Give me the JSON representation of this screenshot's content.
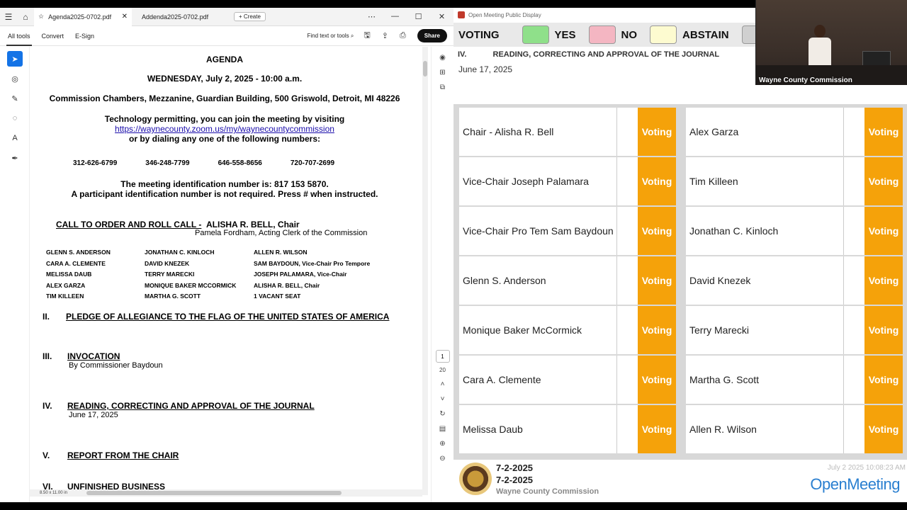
{
  "pdf": {
    "tabs": [
      {
        "label": "Agenda2025-0702.pdf",
        "active": true
      },
      {
        "label": "Addenda2025-0702.pdf",
        "active": false
      }
    ],
    "create_label": "Create",
    "toolbar": {
      "all_tools": "All tools",
      "convert": "Convert",
      "esign": "E-Sign",
      "find": "Find text or tools",
      "share": "Share"
    },
    "page": {
      "title": "AGENDA",
      "date": "WEDNESDAY, July 2, 2025 - 10:00 a.m.",
      "location": "Commission Chambers, Mezzanine, Guardian Building, 500 Griswold, Detroit, MI 48226",
      "tech": "Technology permitting, you can join the meeting by visiting",
      "url": "https://waynecounty.zoom.us/my/waynecountycommission",
      "dial": "or by dialing any one of the following numbers:",
      "phones": [
        "312-626-6799",
        "346-248-7799",
        "646-558-8656",
        "720-707-2699"
      ],
      "meeting_id": "The meeting identification number is: 817 153 5870.",
      "participant": "A participant identification number is not required. Press # when instructed.",
      "call_to_order": "CALL TO ORDER AND ROLL CALL -",
      "chair_name": "ALISHA R. BELL, Chair",
      "clerk": "Pamela Fordham, Acting Clerk of the Commission",
      "roster_col1": [
        "GLENN S. ANDERSON",
        "CARA A. CLEMENTE",
        "MELISSA DAUB",
        "ALEX GARZA",
        "TIM KILLEEN"
      ],
      "roster_col2": [
        "JONATHAN C. KINLOCH",
        "DAVID KNEZEK",
        "TERRY MARECKI",
        "MONIQUE BAKER MCCORMICK",
        "MARTHA G. SCOTT"
      ],
      "roster_col3": [
        "ALLEN R. WILSON",
        "SAM BAYDOUN, Vice-Chair Pro Tempore",
        "JOSEPH PALAMARA, Vice-Chair",
        "ALISHA R. BELL, Chair",
        "1 VACANT SEAT"
      ],
      "sec2_num": "II.",
      "sec2": "PLEDGE OF ALLEGIANCE TO THE FLAG OF THE UNITED STATES OF AMERICA",
      "sec3_num": "III.",
      "sec3": "INVOCATION",
      "sec3_sub": "By Commissioner Baydoun",
      "sec4_num": "IV.",
      "sec4": "READING, CORRECTING AND APPROVAL OF THE JOURNAL",
      "sec4_sub": "June 17, 2025",
      "sec5_num": "V.",
      "sec5": "REPORT FROM THE CHAIR",
      "sec6_num": "VI.",
      "sec6": "UNFINISHED BUSINESS"
    },
    "page_current": "1",
    "page_total": "20",
    "page_size": "8.50 x 11.00 in"
  },
  "om": {
    "window_title": "Open Meeting Public Display",
    "legend": {
      "voting": "VOTING",
      "yes": "YES",
      "no": "NO",
      "abstain": "ABSTAIN",
      "yes_color": "#8fe08a",
      "no_color": "#f4b6c2",
      "abstain_color": "#fdfbd0",
      "other_color": "#d0d0d0"
    },
    "item_num": "IV.",
    "item_title": "READING, CORRECTING AND APPROVAL OF THE JOURNAL",
    "item_date": "June 17, 2025",
    "status_color": "#f5a20a",
    "left_members": [
      {
        "name": "Chair - Alisha R. Bell",
        "status": "Voting"
      },
      {
        "name": "Vice-Chair Joseph Palamara",
        "status": "Voting"
      },
      {
        "name": "Vice-Chair Pro Tem Sam Baydoun",
        "status": "Voting"
      },
      {
        "name": "Glenn S. Anderson",
        "status": "Voting"
      },
      {
        "name": "Monique Baker McCormick",
        "status": "Voting"
      },
      {
        "name": "Cara A. Clemente",
        "status": "Voting"
      },
      {
        "name": "Melissa Daub",
        "status": "Voting"
      }
    ],
    "right_members": [
      {
        "name": "Alex Garza",
        "status": "Voting"
      },
      {
        "name": "Tim Killeen",
        "status": "Voting"
      },
      {
        "name": "Jonathan C. Kinloch",
        "status": "Voting"
      },
      {
        "name": "David Knezek",
        "status": "Voting"
      },
      {
        "name": "Terry Marecki",
        "status": "Voting"
      },
      {
        "name": "Martha G. Scott",
        "status": "Voting"
      },
      {
        "name": "Allen R.  Wilson",
        "status": "Voting"
      }
    ],
    "footer": {
      "date1": "7-2-2025",
      "date2": "7-2-2025",
      "org": "Wayne County Commission",
      "timestamp": "July 2 2025 10:08:23 AM",
      "logo": "OpenMeeting"
    }
  },
  "video": {
    "caption": "Wayne County Commission"
  }
}
